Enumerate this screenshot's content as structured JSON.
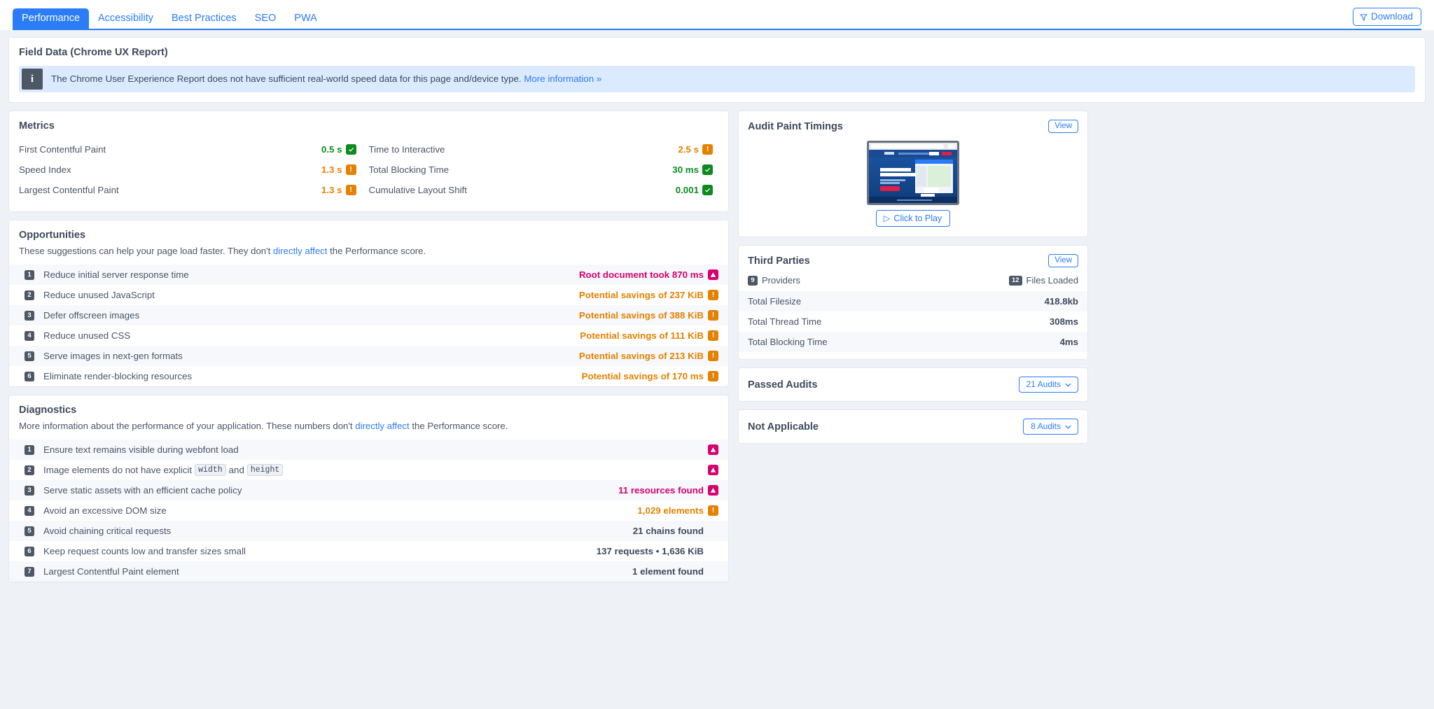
{
  "tabs": [
    {
      "label": "Performance",
      "active": true
    },
    {
      "label": "Accessibility",
      "active": false
    },
    {
      "label": "Best Practices",
      "active": false
    },
    {
      "label": "SEO",
      "active": false
    },
    {
      "label": "PWA",
      "active": false
    }
  ],
  "toolbar": {
    "download_label": "Download",
    "download_icon": "funnel-icon"
  },
  "field_data": {
    "title": "Field Data (Chrome UX Report)",
    "info_icon": "info-icon",
    "notice_text": "The Chrome User Experience Report does not have sufficient real-world speed data for this page and/device type.",
    "notice_link": "More information »"
  },
  "metrics": {
    "title": "Metrics",
    "items": [
      {
        "label": "First Contentful Paint",
        "value": "0.5 s",
        "status": "pass",
        "col": "left"
      },
      {
        "label": "Time to Interactive",
        "value": "2.5 s",
        "status": "average",
        "col": "right"
      },
      {
        "label": "Speed Index",
        "value": "1.3 s",
        "status": "average",
        "col": "left"
      },
      {
        "label": "Total Blocking Time",
        "value": "30 ms",
        "status": "pass",
        "col": "right"
      },
      {
        "label": "Largest Contentful Paint",
        "value": "1.3 s",
        "status": "average",
        "col": "left"
      },
      {
        "label": "Cumulative Layout Shift",
        "value": "0.001",
        "status": "pass",
        "col": "right"
      }
    ]
  },
  "opportunities": {
    "title": "Opportunities",
    "desc_before": "These suggestions can help your page load faster. They don't ",
    "desc_link": "directly affect",
    "desc_after": " the Performance score.",
    "items": [
      {
        "index": "1",
        "title": "Reduce initial server response time",
        "value": "Root document took 870 ms",
        "status": "fail"
      },
      {
        "index": "2",
        "title": "Reduce unused JavaScript",
        "value": "Potential savings of 237 KiB",
        "status": "average"
      },
      {
        "index": "3",
        "title": "Defer offscreen images",
        "value": "Potential savings of 388 KiB",
        "status": "average"
      },
      {
        "index": "4",
        "title": "Reduce unused CSS",
        "value": "Potential savings of 111 KiB",
        "status": "average"
      },
      {
        "index": "5",
        "title": "Serve images in next-gen formats",
        "value": "Potential savings of 213 KiB",
        "status": "average"
      },
      {
        "index": "6",
        "title": "Eliminate render-blocking resources",
        "value": "Potential savings of 170 ms",
        "status": "average"
      }
    ]
  },
  "diagnostics": {
    "title": "Diagnostics",
    "desc_before": "More information about the performance of your application. These numbers don't ",
    "desc_link": "directly affect",
    "desc_after": " the Performance score.",
    "items": [
      {
        "index": "1",
        "title": "Ensure text remains visible during webfont load",
        "value": "",
        "status": "fail"
      },
      {
        "index": "2",
        "title": "Image elements do not have explicit",
        "code1": "width",
        "mid": "and",
        "code2": "height",
        "value": "",
        "status": "fail"
      },
      {
        "index": "3",
        "title": "Serve static assets with an efficient cache policy",
        "value": "11 resources found",
        "status": "fail"
      },
      {
        "index": "4",
        "title": "Avoid an excessive DOM size",
        "value": "1,029 elements",
        "status": "average"
      },
      {
        "index": "5",
        "title": "Avoid chaining critical requests",
        "value": "21 chains found",
        "status": "none"
      },
      {
        "index": "6",
        "title": "Keep request counts low and transfer sizes small",
        "value": "137 requests • 1,636 KiB",
        "status": "none"
      },
      {
        "index": "7",
        "title": "Largest Contentful Paint element",
        "value": "1 element found",
        "status": "none"
      }
    ]
  },
  "audit_paint_timings": {
    "title": "Audit Paint Timings",
    "view_label": "View",
    "play_label": "Click to Play",
    "play_icon": "play-icon",
    "thumbnail_name": "page-screenshot-thumbnail"
  },
  "third_parties": {
    "title": "Third Parties",
    "view_label": "View",
    "providers_count": "9",
    "providers_label": "Providers",
    "files_count": "12",
    "files_label": "Files Loaded",
    "rows": [
      {
        "label": "Total Filesize",
        "value": "418.8kb"
      },
      {
        "label": "Total Thread Time",
        "value": "308ms"
      },
      {
        "label": "Total Blocking Time",
        "value": "4ms"
      }
    ]
  },
  "passed_audits": {
    "title": "Passed Audits",
    "button_label": "21 Audits",
    "chevron": "chevron-down-icon"
  },
  "not_applicable": {
    "title": "Not Applicable",
    "button_label": "8 Audits",
    "chevron": "chevron-down-icon"
  },
  "colors": {
    "accent": "#2a7cf7",
    "pass": "#0c8a1e",
    "average": "#e38100",
    "fail": "#d6006e",
    "text": "#4a5568",
    "page_bg": "#eef1f6"
  }
}
